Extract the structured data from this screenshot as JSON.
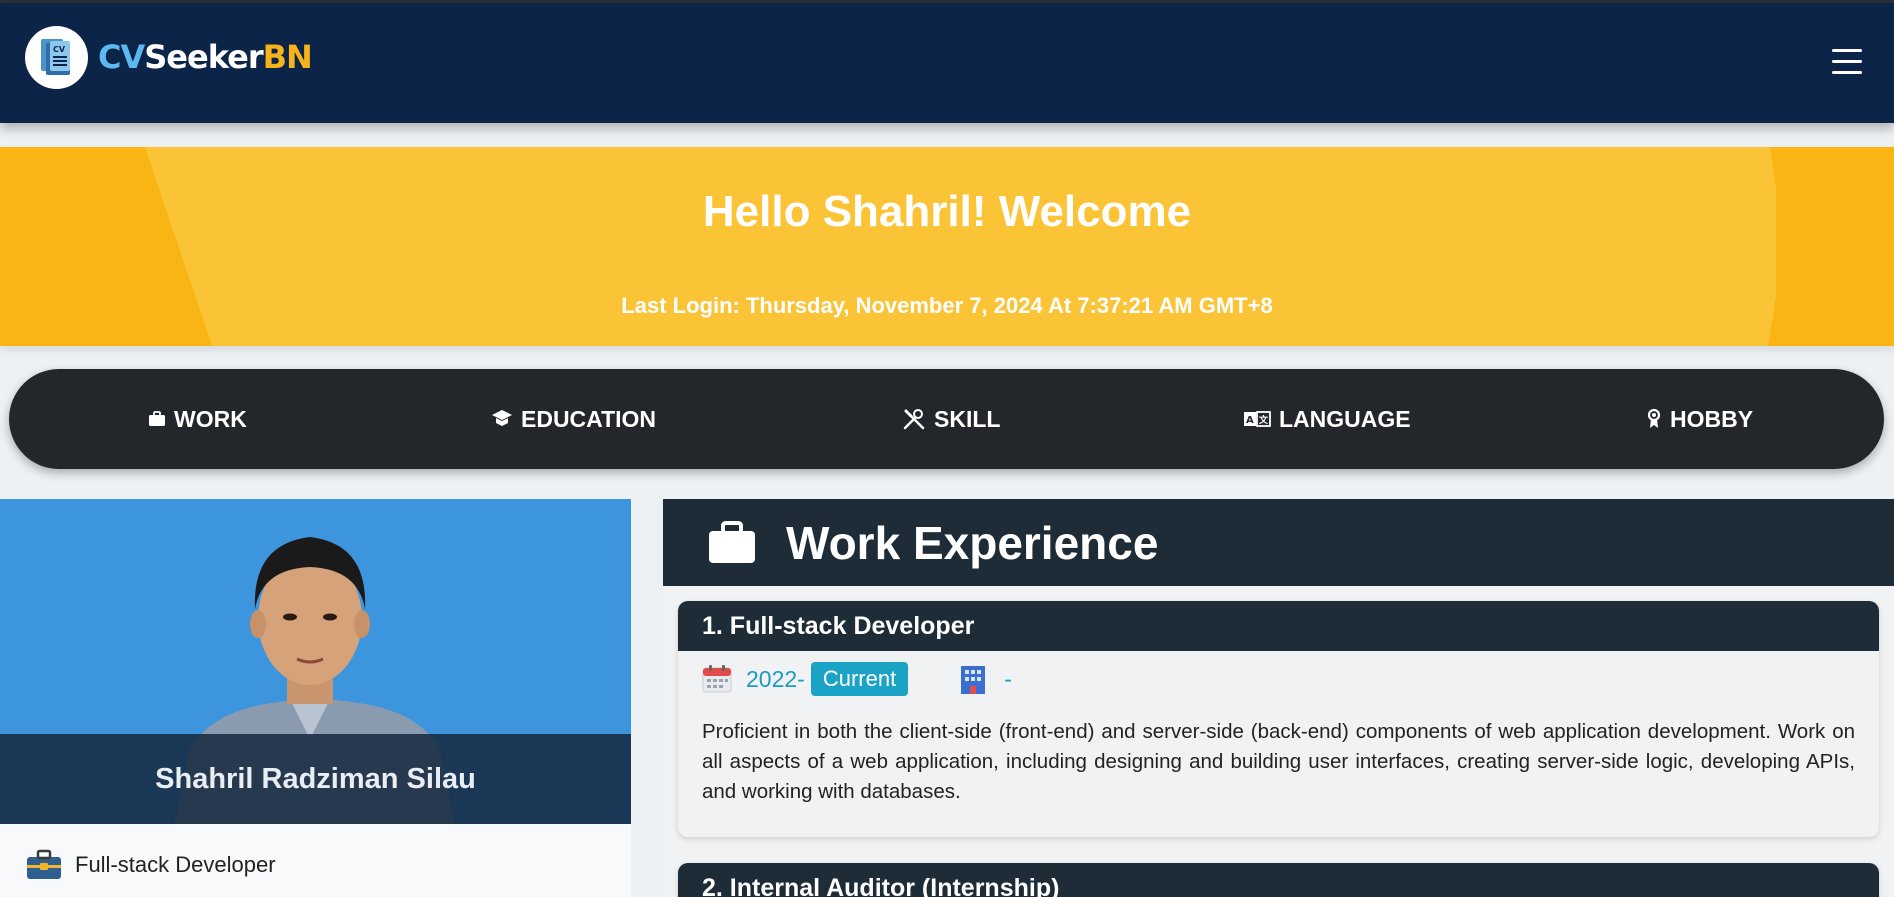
{
  "brand": {
    "logo_icon": "cv-document-icon",
    "part1": "CV",
    "part2": "Seeker",
    "part3": "BN"
  },
  "navbar": {
    "menu_icon": "hamburger-menu-icon"
  },
  "banner": {
    "title": "Hello Shahril! Welcome",
    "last_login": "Last Login: Thursday, November 7, 2024 At 7:37:21 AM GMT+8"
  },
  "tabs": [
    {
      "label": "WORK",
      "icon": "briefcase-icon"
    },
    {
      "label": "EDUCATION",
      "icon": "graduation-cap-icon"
    },
    {
      "label": "SKILL",
      "icon": "tools-icon"
    },
    {
      "label": "LANGUAGE",
      "icon": "translate-icon"
    },
    {
      "label": "HOBBY",
      "icon": "award-icon"
    }
  ],
  "profile": {
    "name": "Shahril Radziman Silau",
    "role": "Full-stack Developer",
    "role_icon": "toolbox-icon"
  },
  "work": {
    "header": "Work Experience",
    "header_icon": "briefcase-icon",
    "jobs": [
      {
        "title": "1. Full-stack Developer",
        "start": "2022-",
        "end_badge": "Current",
        "company": "-",
        "description": "Proficient in both the client-side (front-end) and server-side (back-end) components of web application development. Work on all aspects of a web application, including designing and building user interfaces, creating server-side logic, developing APIs, and working with databases."
      },
      {
        "title": "2. Internal Auditor (Internship)"
      }
    ]
  },
  "colors": {
    "navbar": "#0b2448",
    "banner": "#f9b514",
    "tabbar": "#23272c",
    "accent": "#1ba3c6",
    "profile_bg": "#3d96dd"
  }
}
